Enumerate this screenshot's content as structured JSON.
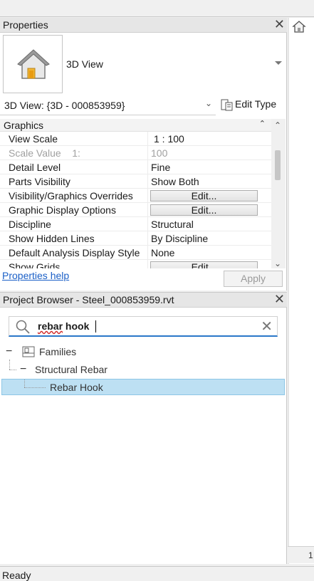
{
  "properties": {
    "title": "Properties",
    "type_name": "3D View",
    "view_selector": "3D View: {3D - 000853959}",
    "edit_type_label": "Edit Type",
    "group_label": "Graphics",
    "rows": [
      {
        "name": "View Scale",
        "value": "1 : 100"
      },
      {
        "name": "Scale Value    1:",
        "value": "100"
      },
      {
        "name": "Detail Level",
        "value": "Fine"
      },
      {
        "name": "Parts Visibility",
        "value": "Show Both"
      },
      {
        "name": "Visibility/Graphics Overrides",
        "value": "Edit..."
      },
      {
        "name": "Graphic Display Options",
        "value": "Edit..."
      },
      {
        "name": "Discipline",
        "value": "Structural"
      },
      {
        "name": "Show Hidden Lines",
        "value": "By Discipline"
      },
      {
        "name": "Default Analysis Display Style",
        "value": "None"
      },
      {
        "name": "Show Grids",
        "value": "Edit..."
      }
    ],
    "help_link": "Properties help",
    "apply_label": "Apply"
  },
  "project_browser": {
    "title": "Project Browser - Steel_000853959.rvt",
    "search_value": "rebar hook",
    "tree": {
      "families": "Families",
      "structural_rebar": "Structural Rebar",
      "rebar_hook": "Rebar Hook"
    }
  },
  "right_panel": {
    "number": "1"
  },
  "status": {
    "text": "Ready"
  },
  "icons": [
    "close-icon",
    "house-icon",
    "edit-type-icon",
    "search-icon",
    "clear-icon",
    "collapse-icon",
    "families-icon",
    "scroll-up-icon",
    "scroll-down-icon"
  ]
}
